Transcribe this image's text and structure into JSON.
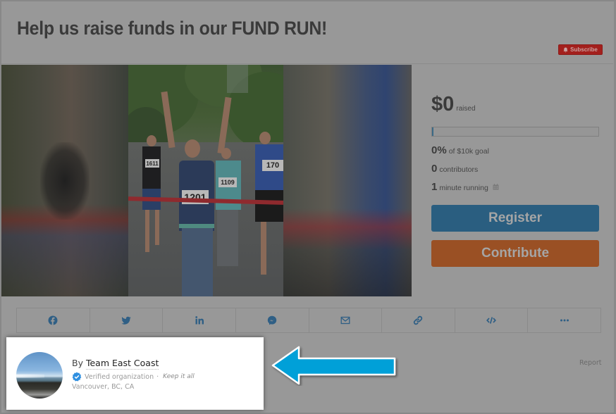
{
  "header": {
    "title": "Help us raise funds in our FUND RUN!",
    "subscribe_label": "Subscribe",
    "subscribe_icon": "bell-icon"
  },
  "media": {
    "description": "Runners crossing a red finish-line ribbon in a park",
    "bibs": [
      "1201",
      "1109",
      "1611",
      "170"
    ]
  },
  "campaign": {
    "raised_amount": "$0",
    "raised_label": "raised",
    "progress_percent": 0,
    "percent_value": "0%",
    "percent_label": "of $10k goal",
    "contributors_value": "0",
    "contributors_label": "contributors",
    "running_value": "1",
    "running_label": "minute running",
    "running_icon": "calendar-icon",
    "register_label": "Register",
    "contribute_label": "Contribute"
  },
  "share": {
    "items": [
      {
        "name": "facebook",
        "icon": "facebook-icon"
      },
      {
        "name": "twitter",
        "icon": "twitter-icon"
      },
      {
        "name": "linkedin",
        "icon": "linkedin-icon"
      },
      {
        "name": "messenger",
        "icon": "messenger-icon"
      },
      {
        "name": "email",
        "icon": "envelope-icon"
      },
      {
        "name": "copy-link",
        "icon": "link-icon"
      },
      {
        "name": "embed",
        "icon": "code-icon"
      },
      {
        "name": "more",
        "icon": "ellipsis-icon"
      }
    ]
  },
  "organizer": {
    "by_label": "By",
    "name": "Team East Coast",
    "verified_label": "Verified organization",
    "separator": "·",
    "keep_label": "Keep it all",
    "location": "Vancouver, BC, CA"
  },
  "report_label": "Report",
  "colors": {
    "register": "#2a5e80",
    "contribute": "#9a5024",
    "subscribe": "#a3201d",
    "share_icons": "#2f5f85",
    "annotation_arrow": "#00a0d8",
    "verified_badge": "#2f8fe0"
  }
}
